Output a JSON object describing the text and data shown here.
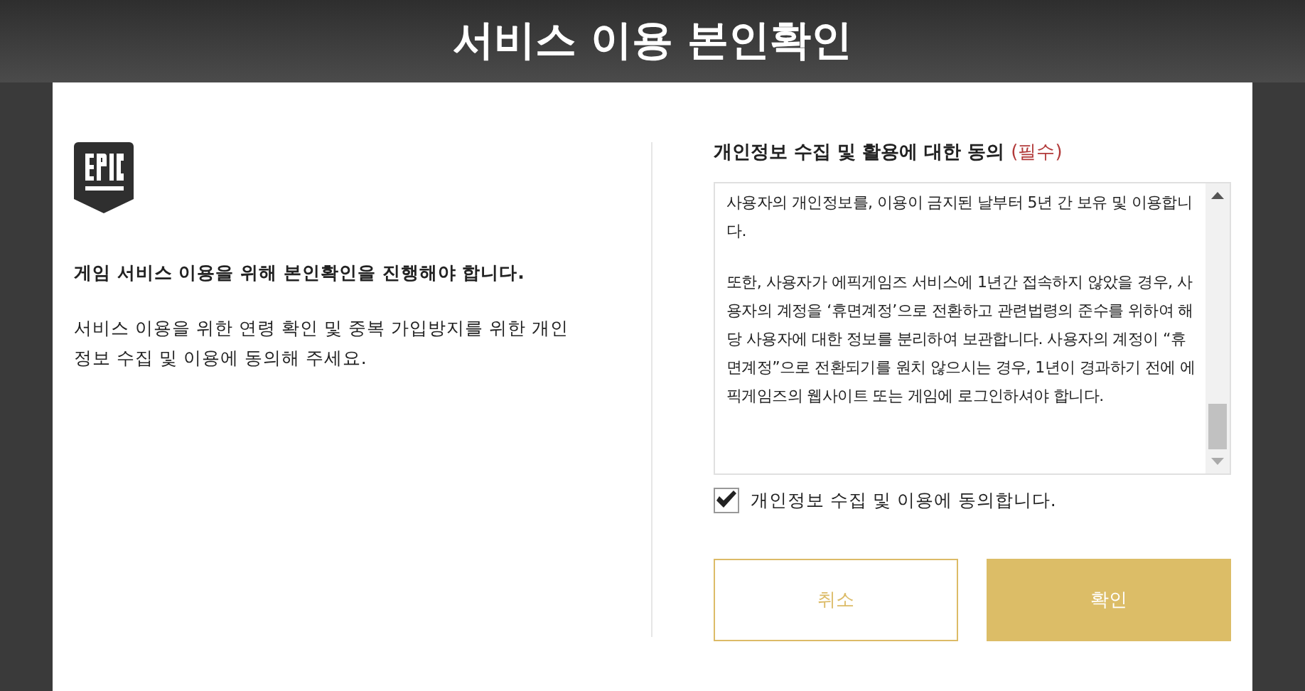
{
  "header": {
    "title": "서비스 이용 본인확인"
  },
  "intro": {
    "heading": "게임 서비스 이용을 위해 본인확인을 진행해야 합니다.",
    "description": "서비스 이용을 위한 연령 확인 및 중복 가입방지를 위한 개인 정보 수집 및 이용에 동의해 주세요."
  },
  "consent": {
    "title": "개인정보 수집 및 활용에 대한 동의",
    "required": "(필수)",
    "paragraphs": [
      "사용자의 개인정보를, 이용이 금지된 날부터 5년 간 보유 및 이용합니다.",
      "또한, 사용자가 에픽게임즈 서비스에 1년간 접속하지 않았을 경우, 사용자의 계정을 ‘휴면계정’으로 전환하고 관련법령의 준수를 위하여 해당 사용자에 대한 정보를 분리하여 보관합니다. 사용자의 계정이 “휴면계정”으로 전환되기를 원치 않으시는 경우, 1년이 경과하기 전에 에픽게임즈의 웹사이트 또는 게임에 로그인하셔야 합니다."
    ],
    "agree": {
      "label": "개인정보 수집 및 이용에 동의합니다.",
      "checked": true
    }
  },
  "buttons": [
    {
      "label": "취소",
      "kind": "outline"
    },
    {
      "label": "확인",
      "kind": "primary"
    }
  ]
}
